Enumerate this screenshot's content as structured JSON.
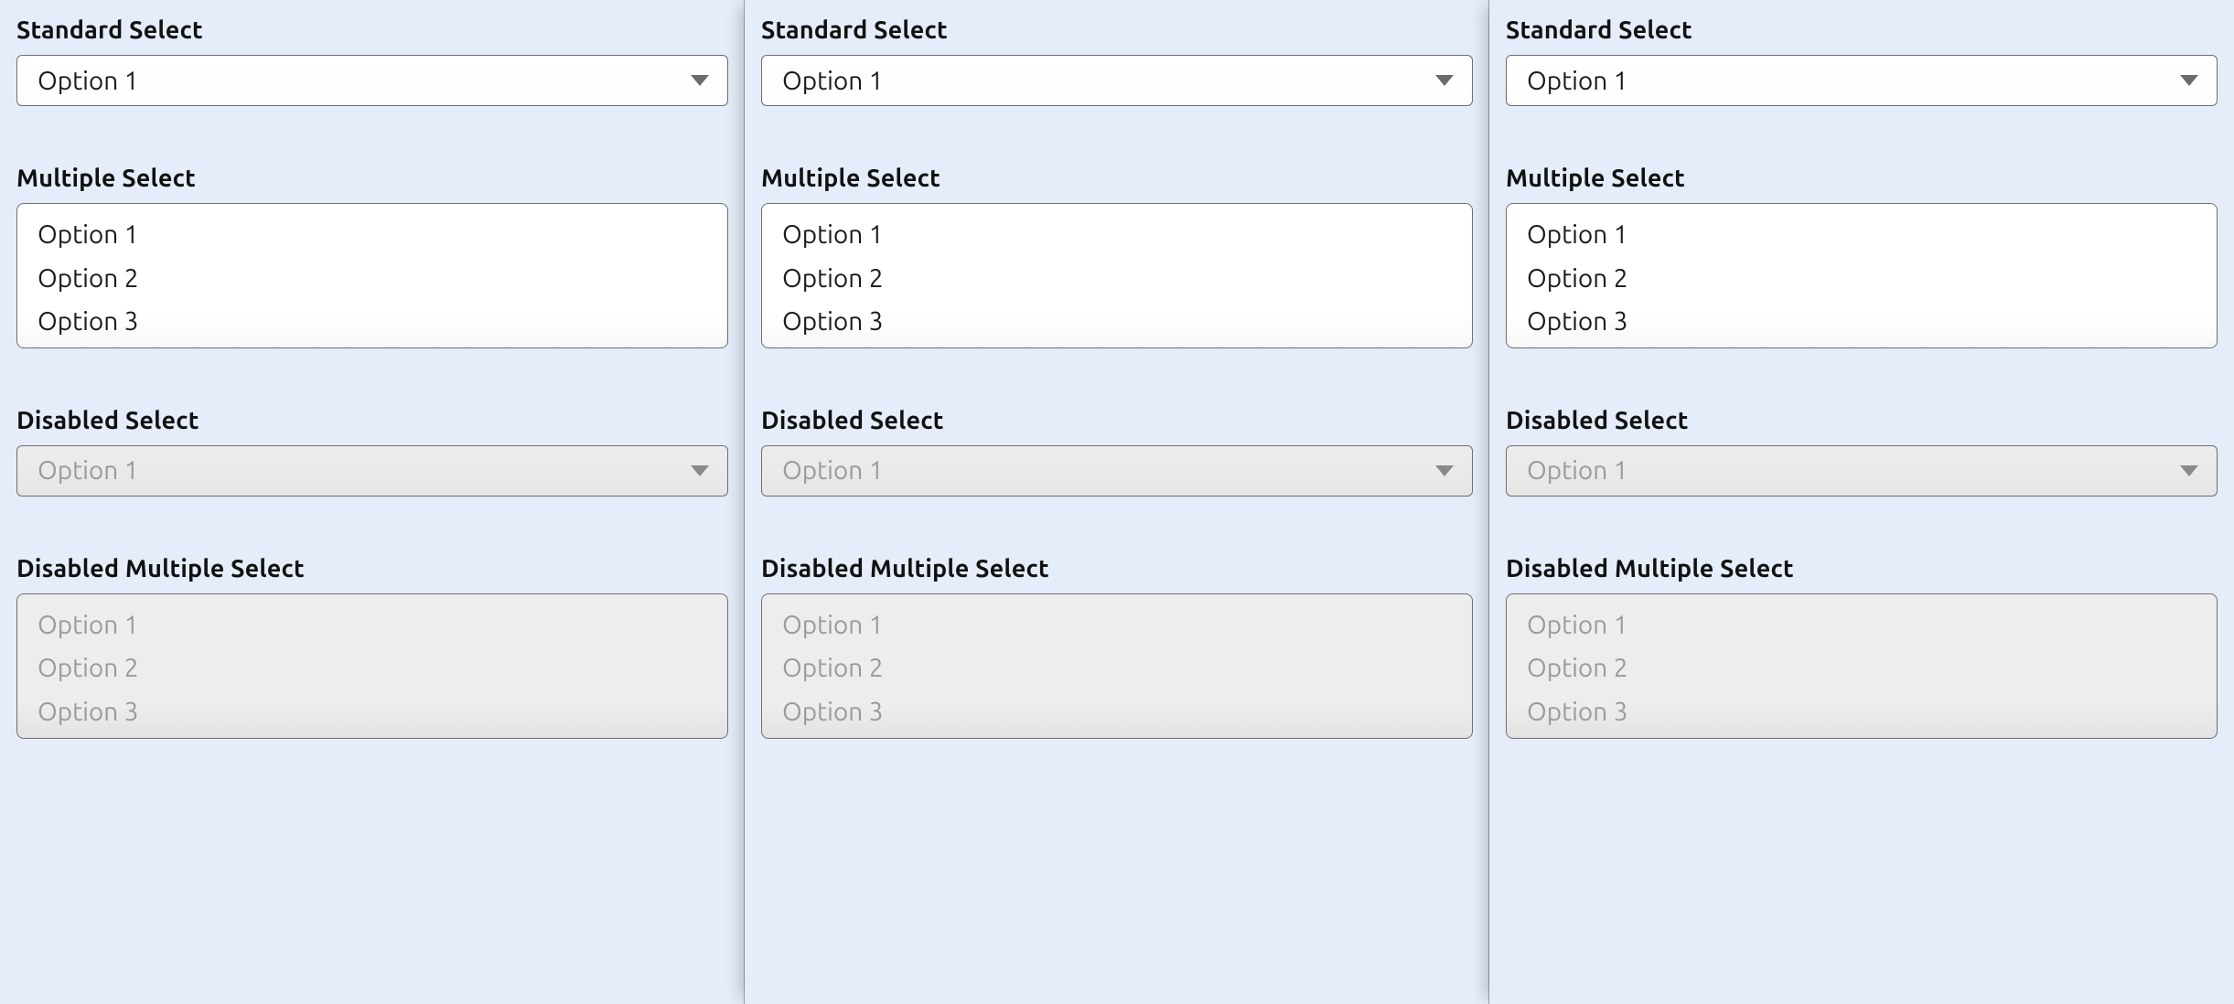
{
  "labels": {
    "standard": "Standard Select",
    "multiple": "Multiple Select",
    "disabled": "Disabled Select",
    "disabled_multiple": "Disabled Multiple Select"
  },
  "options": {
    "o1": "Option 1",
    "o2": "Option 2",
    "o3": "Option 3"
  },
  "standard_value": "Option 1",
  "disabled_value": "Option 1",
  "colors": {
    "page_bg": "#e4edf9",
    "border": "#6f6f6f",
    "text": "#1a1a1a",
    "disabled_text": "#9a9a9a",
    "disabled_bg": "#ededed",
    "chev": "#6b6b6b"
  }
}
